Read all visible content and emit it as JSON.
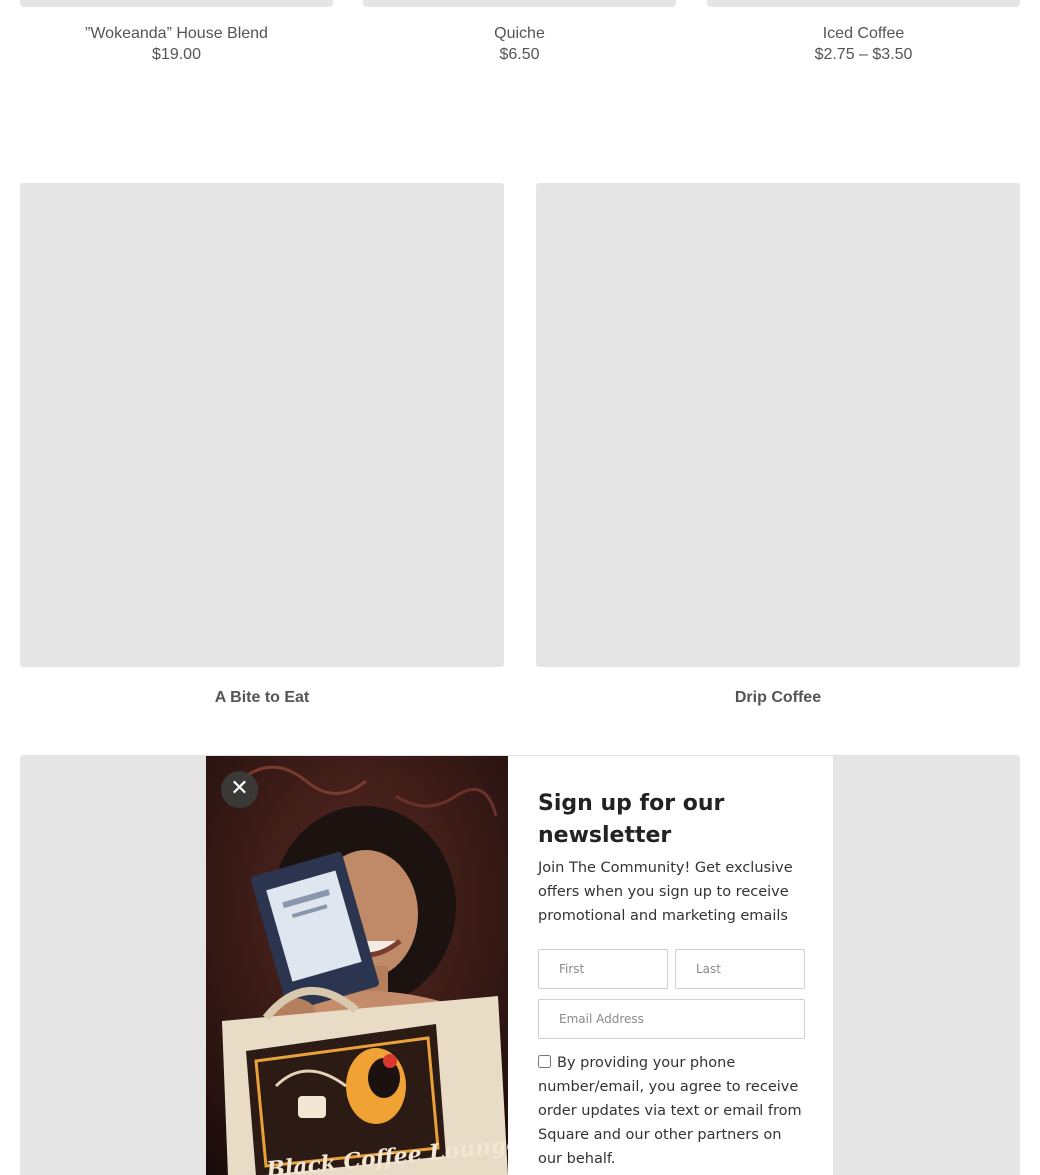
{
  "products": [
    {
      "name": "”Wokeanda” House Blend",
      "price": "$19.00"
    },
    {
      "name": "Quiche",
      "price": "$6.50"
    },
    {
      "name": "Iced Coffee",
      "price": "$2.75 – $3.50"
    }
  ],
  "categories": [
    {
      "label": "A Bite to Eat"
    },
    {
      "label": "Drip Coffee"
    }
  ],
  "newsletter": {
    "close_icon": "close-icon",
    "close_glyph": "✕",
    "title": "Sign up for our newsletter",
    "description": "Join The Community! Get exclusive offers when you sign up to receive promotional and marketing emails",
    "first_placeholder": "First",
    "last_placeholder": "Last",
    "email_placeholder": "Email Address",
    "consent_text": "By providing your phone number/email, you agree to receive order updates via text or email from Square and our other partners on our behalf.",
    "consent_checked": false,
    "image_banner_text": "Black Coffee Lounge"
  },
  "colors": {
    "placeholder_gray": "#e5e5e5",
    "text_gray": "#555555",
    "title_dark": "#222222"
  }
}
